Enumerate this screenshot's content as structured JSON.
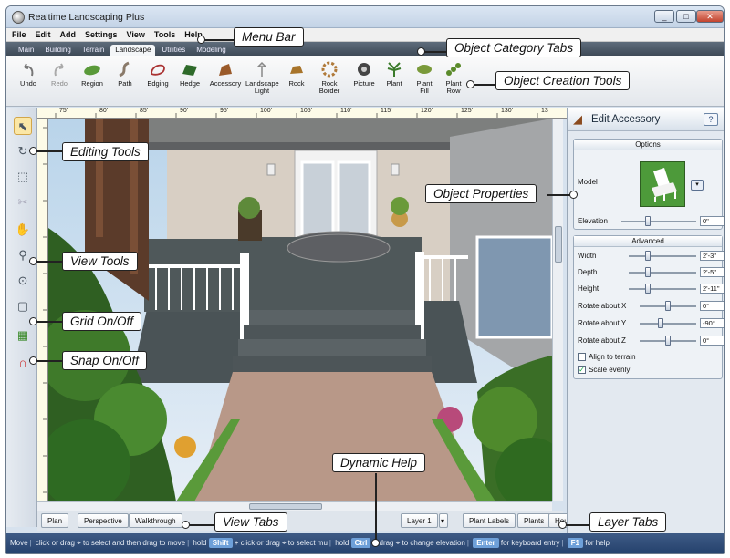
{
  "window": {
    "title": "Realtime Landscaping Plus",
    "controls": [
      "_",
      "□",
      "✕"
    ]
  },
  "menu": [
    "File",
    "Edit",
    "Add",
    "Settings",
    "View",
    "Tools",
    "Help"
  ],
  "category_tabs": {
    "items": [
      "Main",
      "Building",
      "Terrain",
      "Landscape",
      "Utilities",
      "Modeling"
    ],
    "active": "Landscape"
  },
  "toolbar": [
    {
      "label": "Undo",
      "icon": "undo-icon"
    },
    {
      "label": "Redo",
      "icon": "redo-icon"
    },
    {
      "label": "Region",
      "icon": "region-icon"
    },
    {
      "label": "Path",
      "icon": "path-icon"
    },
    {
      "label": "Edging",
      "icon": "edging-icon"
    },
    {
      "label": "Hedge",
      "icon": "hedge-icon"
    },
    {
      "label": "Accessory",
      "icon": "accessory-icon"
    },
    {
      "label": "Landscape Light",
      "icon": "landscape-light-icon"
    },
    {
      "label": "Rock",
      "icon": "rock-icon"
    },
    {
      "label": "Rock Border",
      "icon": "rock-border-icon"
    },
    {
      "label": "Picture",
      "icon": "picture-icon"
    },
    {
      "label": "Plant",
      "icon": "plant-icon"
    },
    {
      "label": "Plant Fill",
      "icon": "plant-fill-icon"
    },
    {
      "label": "Plant Row",
      "icon": "plant-row-icon"
    }
  ],
  "left_tools": [
    "pointer-icon",
    "rotate-icon",
    "node-edit-icon",
    "trim-icon",
    "pan-hand-icon",
    "zoom-icon",
    "zoom-extents-icon",
    "zoom-window-icon",
    "grid-icon",
    "snap-magnet-icon"
  ],
  "ruler": [
    "75'",
    "80'",
    "85'",
    "90'",
    "95'",
    "100'",
    "105'",
    "110'",
    "115'",
    "120'",
    "125'",
    "130'",
    "13"
  ],
  "panel": {
    "title": "Edit Accessory",
    "help_label": "?",
    "options": {
      "header": "Options",
      "model_label": "Model",
      "elevation_label": "Elevation",
      "elevation_value": "0\""
    },
    "advanced": {
      "header": "Advanced",
      "fields": [
        {
          "label": "Width",
          "value": "2'-3\""
        },
        {
          "label": "Depth",
          "value": "2'-5\""
        },
        {
          "label": "Height",
          "value": "2'-11\""
        },
        {
          "label": "Rotate about X",
          "value": "0°"
        },
        {
          "label": "Rotate about Y",
          "value": "-90°"
        },
        {
          "label": "Rotate about Z",
          "value": "0°"
        }
      ],
      "checkboxes": [
        {
          "label": "Align to terrain",
          "checked": false
        },
        {
          "label": "Scale evenly",
          "checked": true
        }
      ]
    }
  },
  "view_tabs": [
    "Plan",
    "Perspective",
    "Walkthrough"
  ],
  "layer_tabs": [
    "Layer 1",
    "Plant Labels",
    "Plants",
    "House"
  ],
  "status": {
    "s1": "Move",
    "s2": "click or drag",
    "s3": "to select and then drag to move",
    "s4": "hold",
    "k1": "Shift",
    "s5": "+ click or drag",
    "s6": "to select mu",
    "s7": "hold",
    "k2": "Ctrl",
    "s8": "+ drag",
    "s9": "to change elevation",
    "k3": "Enter",
    "s10": "for keyboard entry",
    "k4": "F1",
    "s11": "for help"
  },
  "callouts": {
    "menu_bar": "Menu Bar",
    "category_tabs": "Object Category Tabs",
    "creation_tools": "Object Creation Tools",
    "editing_tools": "Editing Tools",
    "object_properties": "Object Properties",
    "view_tools": "View Tools",
    "grid": "Grid On/Off",
    "snap": "Snap On/Off",
    "dynamic_help": "Dynamic Help",
    "view_tabs": "View Tabs",
    "layer_tabs": "Layer Tabs"
  },
  "colors": {
    "accent": "#3e5b86",
    "chair_green": "#4d9a3a",
    "porch_deck": "#4a5356",
    "path_gravel": "#b89888"
  }
}
